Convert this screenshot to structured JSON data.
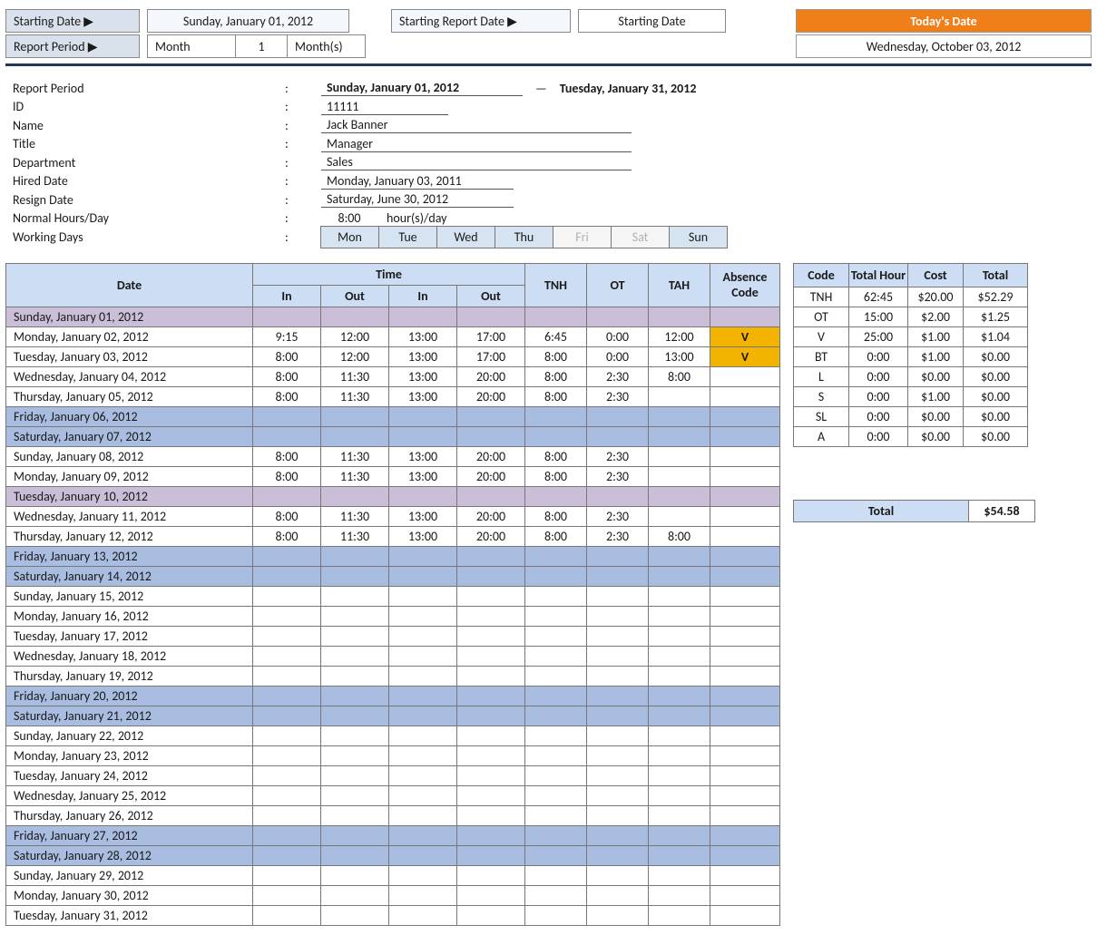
{
  "header": {
    "start_date_label": "Starting Date ▶",
    "start_date_value": "Sunday, January 01, 2012",
    "starting_report_label": "Starting Report Date ▶",
    "starting_report_value": "Starting Date",
    "report_period_label": "Report Period ▶",
    "report_period_month": "Month",
    "report_period_qty": "1",
    "report_period_unit": "Month(s)",
    "today_label": "Today's Date",
    "today_value": "Wednesday, October 03, 2012"
  },
  "info": {
    "labels": {
      "period": "Report Period",
      "id": "ID",
      "name": "Name",
      "title": "Title",
      "dept": "Department",
      "hired": "Hired Date",
      "resign": "Resign Date",
      "normal": "Normal Hours/Day",
      "working": "Working Days"
    },
    "period_start": "Sunday, January 01, 2012",
    "period_dash": "—",
    "period_end": "Tuesday, January 31, 2012",
    "id": "11111",
    "name": "Jack Banner",
    "title": "Manager",
    "dept": "Sales",
    "hired": "Monday, January 03, 2011",
    "resign": "Saturday, June 30, 2012",
    "normal_hours": "8:00",
    "normal_unit": "hour(s)/day",
    "days": [
      {
        "lbl": "Mon",
        "on": true
      },
      {
        "lbl": "Tue",
        "on": true
      },
      {
        "lbl": "Wed",
        "on": true
      },
      {
        "lbl": "Thu",
        "on": true
      },
      {
        "lbl": "Fri",
        "on": false
      },
      {
        "lbl": "Sat",
        "on": false
      },
      {
        "lbl": "Sun",
        "on": true
      }
    ]
  },
  "timesheet": {
    "headers": {
      "date": "Date",
      "time": "Time",
      "in": "In",
      "out": "Out",
      "tnh": "TNH",
      "ot": "OT",
      "tah": "TAH",
      "abs": "Absence Code"
    },
    "rows": [
      {
        "date": "Sunday, January 01, 2012",
        "kind": "holiday"
      },
      {
        "date": "Monday, January 02, 2012",
        "in1": "9:15",
        "out1": "12:00",
        "in2": "13:00",
        "out2": "17:00",
        "tnh": "6:45",
        "ot": "0:00",
        "tah": "12:00",
        "abs": "V",
        "abs_hl": true
      },
      {
        "date": "Tuesday, January 03, 2012",
        "in1": "8:00",
        "out1": "12:00",
        "in2": "13:00",
        "out2": "17:00",
        "tnh": "8:00",
        "ot": "0:00",
        "tah": "13:00",
        "abs": "V",
        "abs_hl": true
      },
      {
        "date": "Wednesday, January 04, 2012",
        "in1": "8:00",
        "out1": "11:30",
        "in2": "13:00",
        "out2": "20:00",
        "tnh": "8:00",
        "ot": "2:30",
        "tah": "8:00"
      },
      {
        "date": "Thursday, January 05, 2012",
        "in1": "8:00",
        "out1": "11:30",
        "in2": "13:00",
        "out2": "20:00",
        "tnh": "8:00",
        "ot": "2:30"
      },
      {
        "date": "Friday, January 06, 2012",
        "kind": "weekend"
      },
      {
        "date": "Saturday, January 07, 2012",
        "kind": "weekend"
      },
      {
        "date": "Sunday, January 08, 2012",
        "in1": "8:00",
        "out1": "11:30",
        "in2": "13:00",
        "out2": "20:00",
        "tnh": "8:00",
        "ot": "2:30"
      },
      {
        "date": "Monday, January 09, 2012",
        "in1": "8:00",
        "out1": "11:30",
        "in2": "13:00",
        "out2": "20:00",
        "tnh": "8:00",
        "ot": "2:30"
      },
      {
        "date": "Tuesday, January 10, 2012",
        "kind": "holiday"
      },
      {
        "date": "Wednesday, January 11, 2012",
        "in1": "8:00",
        "out1": "11:30",
        "in2": "13:00",
        "out2": "20:00",
        "tnh": "8:00",
        "ot": "2:30"
      },
      {
        "date": "Thursday, January 12, 2012",
        "in1": "8:00",
        "out1": "11:30",
        "in2": "13:00",
        "out2": "20:00",
        "tnh": "8:00",
        "ot": "2:30",
        "tah": "8:00"
      },
      {
        "date": "Friday, January 13, 2012",
        "kind": "weekend"
      },
      {
        "date": "Saturday, January 14, 2012",
        "kind": "weekend"
      },
      {
        "date": "Sunday, January 15, 2012"
      },
      {
        "date": "Monday, January 16, 2012"
      },
      {
        "date": "Tuesday, January 17, 2012"
      },
      {
        "date": "Wednesday, January 18, 2012"
      },
      {
        "date": "Thursday, January 19, 2012"
      },
      {
        "date": "Friday, January 20, 2012",
        "kind": "weekend"
      },
      {
        "date": "Saturday, January 21, 2012",
        "kind": "weekend"
      },
      {
        "date": "Sunday, January 22, 2012"
      },
      {
        "date": "Monday, January 23, 2012"
      },
      {
        "date": "Tuesday, January 24, 2012"
      },
      {
        "date": "Wednesday, January 25, 2012"
      },
      {
        "date": "Thursday, January 26, 2012"
      },
      {
        "date": "Friday, January 27, 2012",
        "kind": "weekend"
      },
      {
        "date": "Saturday, January 28, 2012",
        "kind": "weekend"
      },
      {
        "date": "Sunday, January 29, 2012"
      },
      {
        "date": "Monday, January 30, 2012"
      },
      {
        "date": "Tuesday, January 31, 2012"
      }
    ]
  },
  "summary": {
    "headers": {
      "code": "Code",
      "hour": "Total Hour",
      "cost": "Cost",
      "total": "Total"
    },
    "rows": [
      {
        "code": "TNH",
        "hour": "62:45",
        "cost": "$20.00",
        "total": "$52.29"
      },
      {
        "code": "OT",
        "hour": "15:00",
        "cost": "$2.00",
        "total": "$1.25"
      },
      {
        "code": "V",
        "hour": "25:00",
        "cost": "$1.00",
        "total": "$1.04"
      },
      {
        "code": "BT",
        "hour": "0:00",
        "cost": "$1.00",
        "total": "$0.00"
      },
      {
        "code": "L",
        "hour": "0:00",
        "cost": "$0.00",
        "total": "$0.00"
      },
      {
        "code": "S",
        "hour": "0:00",
        "cost": "$1.00",
        "total": "$0.00"
      },
      {
        "code": "SL",
        "hour": "0:00",
        "cost": "$0.00",
        "total": "$0.00"
      },
      {
        "code": "A",
        "hour": "0:00",
        "cost": "$0.00",
        "total": "$0.00"
      }
    ],
    "grand_label": "Total",
    "grand_value": "$54.58"
  }
}
